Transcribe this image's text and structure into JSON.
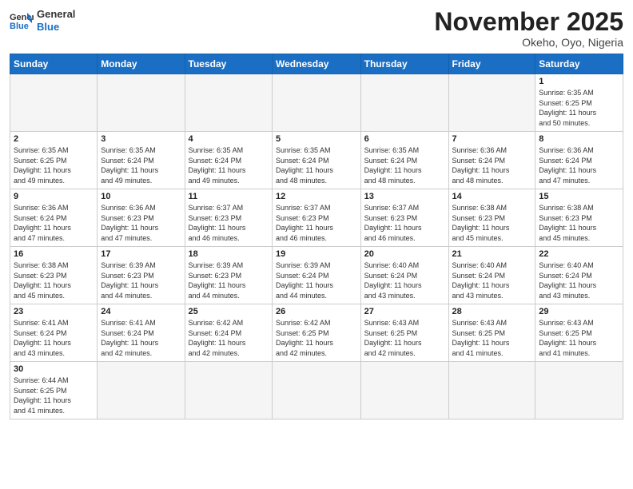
{
  "header": {
    "logo_general": "General",
    "logo_blue": "Blue",
    "month_title": "November 2025",
    "location": "Okeho, Oyo, Nigeria"
  },
  "days_of_week": [
    "Sunday",
    "Monday",
    "Tuesday",
    "Wednesday",
    "Thursday",
    "Friday",
    "Saturday"
  ],
  "weeks": [
    [
      {
        "day": "",
        "info": ""
      },
      {
        "day": "",
        "info": ""
      },
      {
        "day": "",
        "info": ""
      },
      {
        "day": "",
        "info": ""
      },
      {
        "day": "",
        "info": ""
      },
      {
        "day": "",
        "info": ""
      },
      {
        "day": "1",
        "info": "Sunrise: 6:35 AM\nSunset: 6:25 PM\nDaylight: 11 hours\nand 50 minutes."
      }
    ],
    [
      {
        "day": "2",
        "info": "Sunrise: 6:35 AM\nSunset: 6:25 PM\nDaylight: 11 hours\nand 49 minutes."
      },
      {
        "day": "3",
        "info": "Sunrise: 6:35 AM\nSunset: 6:24 PM\nDaylight: 11 hours\nand 49 minutes."
      },
      {
        "day": "4",
        "info": "Sunrise: 6:35 AM\nSunset: 6:24 PM\nDaylight: 11 hours\nand 49 minutes."
      },
      {
        "day": "5",
        "info": "Sunrise: 6:35 AM\nSunset: 6:24 PM\nDaylight: 11 hours\nand 48 minutes."
      },
      {
        "day": "6",
        "info": "Sunrise: 6:35 AM\nSunset: 6:24 PM\nDaylight: 11 hours\nand 48 minutes."
      },
      {
        "day": "7",
        "info": "Sunrise: 6:36 AM\nSunset: 6:24 PM\nDaylight: 11 hours\nand 48 minutes."
      },
      {
        "day": "8",
        "info": "Sunrise: 6:36 AM\nSunset: 6:24 PM\nDaylight: 11 hours\nand 47 minutes."
      }
    ],
    [
      {
        "day": "9",
        "info": "Sunrise: 6:36 AM\nSunset: 6:24 PM\nDaylight: 11 hours\nand 47 minutes."
      },
      {
        "day": "10",
        "info": "Sunrise: 6:36 AM\nSunset: 6:23 PM\nDaylight: 11 hours\nand 47 minutes."
      },
      {
        "day": "11",
        "info": "Sunrise: 6:37 AM\nSunset: 6:23 PM\nDaylight: 11 hours\nand 46 minutes."
      },
      {
        "day": "12",
        "info": "Sunrise: 6:37 AM\nSunset: 6:23 PM\nDaylight: 11 hours\nand 46 minutes."
      },
      {
        "day": "13",
        "info": "Sunrise: 6:37 AM\nSunset: 6:23 PM\nDaylight: 11 hours\nand 46 minutes."
      },
      {
        "day": "14",
        "info": "Sunrise: 6:38 AM\nSunset: 6:23 PM\nDaylight: 11 hours\nand 45 minutes."
      },
      {
        "day": "15",
        "info": "Sunrise: 6:38 AM\nSunset: 6:23 PM\nDaylight: 11 hours\nand 45 minutes."
      }
    ],
    [
      {
        "day": "16",
        "info": "Sunrise: 6:38 AM\nSunset: 6:23 PM\nDaylight: 11 hours\nand 45 minutes."
      },
      {
        "day": "17",
        "info": "Sunrise: 6:39 AM\nSunset: 6:23 PM\nDaylight: 11 hours\nand 44 minutes."
      },
      {
        "day": "18",
        "info": "Sunrise: 6:39 AM\nSunset: 6:23 PM\nDaylight: 11 hours\nand 44 minutes."
      },
      {
        "day": "19",
        "info": "Sunrise: 6:39 AM\nSunset: 6:24 PM\nDaylight: 11 hours\nand 44 minutes."
      },
      {
        "day": "20",
        "info": "Sunrise: 6:40 AM\nSunset: 6:24 PM\nDaylight: 11 hours\nand 43 minutes."
      },
      {
        "day": "21",
        "info": "Sunrise: 6:40 AM\nSunset: 6:24 PM\nDaylight: 11 hours\nand 43 minutes."
      },
      {
        "day": "22",
        "info": "Sunrise: 6:40 AM\nSunset: 6:24 PM\nDaylight: 11 hours\nand 43 minutes."
      }
    ],
    [
      {
        "day": "23",
        "info": "Sunrise: 6:41 AM\nSunset: 6:24 PM\nDaylight: 11 hours\nand 43 minutes."
      },
      {
        "day": "24",
        "info": "Sunrise: 6:41 AM\nSunset: 6:24 PM\nDaylight: 11 hours\nand 42 minutes."
      },
      {
        "day": "25",
        "info": "Sunrise: 6:42 AM\nSunset: 6:24 PM\nDaylight: 11 hours\nand 42 minutes."
      },
      {
        "day": "26",
        "info": "Sunrise: 6:42 AM\nSunset: 6:25 PM\nDaylight: 11 hours\nand 42 minutes."
      },
      {
        "day": "27",
        "info": "Sunrise: 6:43 AM\nSunset: 6:25 PM\nDaylight: 11 hours\nand 42 minutes."
      },
      {
        "day": "28",
        "info": "Sunrise: 6:43 AM\nSunset: 6:25 PM\nDaylight: 11 hours\nand 41 minutes."
      },
      {
        "day": "29",
        "info": "Sunrise: 6:43 AM\nSunset: 6:25 PM\nDaylight: 11 hours\nand 41 minutes."
      }
    ],
    [
      {
        "day": "30",
        "info": "Sunrise: 6:44 AM\nSunset: 6:25 PM\nDaylight: 11 hours\nand 41 minutes."
      },
      {
        "day": "",
        "info": ""
      },
      {
        "day": "",
        "info": ""
      },
      {
        "day": "",
        "info": ""
      },
      {
        "day": "",
        "info": ""
      },
      {
        "day": "",
        "info": ""
      },
      {
        "day": "",
        "info": ""
      }
    ]
  ]
}
